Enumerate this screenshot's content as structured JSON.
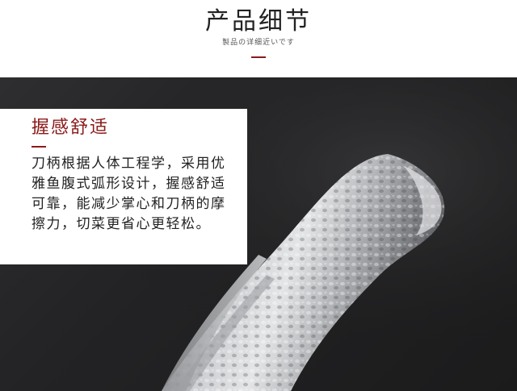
{
  "header": {
    "title": "产品细节",
    "subtitle": "製品の详细近いです"
  },
  "card": {
    "title": "握感舒适",
    "body_lines": [
      "刀柄根据人体工程学，采用优",
      "雅鱼腹式弧形设计，握感舒适",
      "可靠，能减少掌心和刀柄的摩",
      "擦力，切菜更省心更轻松。"
    ]
  },
  "colors": {
    "accent": "#8b1a1a",
    "background_dark": "#232325",
    "text": "#222222"
  }
}
